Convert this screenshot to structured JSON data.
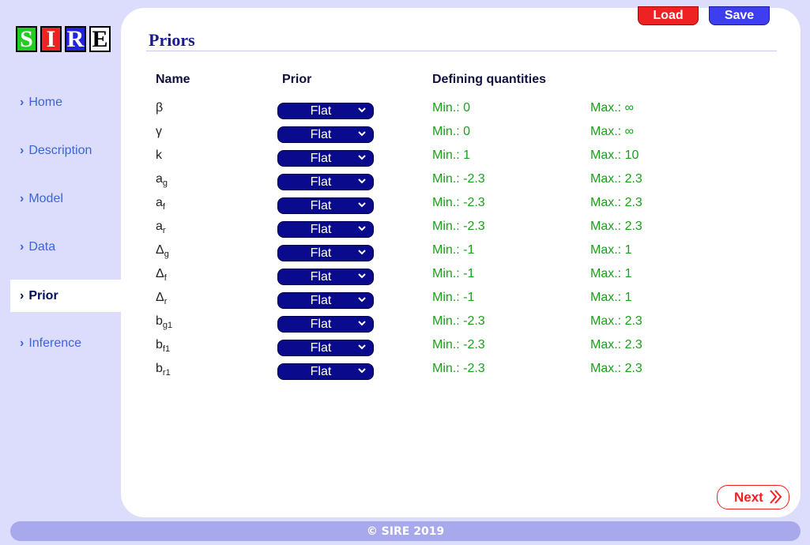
{
  "logo": {
    "letters": [
      {
        "char": "S",
        "color": "#22cc22"
      },
      {
        "char": "I",
        "color": "#ee2222"
      },
      {
        "char": "R",
        "color": "#2222dd"
      },
      {
        "char": "E",
        "color": "#ffffff"
      }
    ]
  },
  "sidebar": {
    "items": [
      {
        "label": "Home",
        "active": false
      },
      {
        "label": "Description",
        "active": false
      },
      {
        "label": "Model",
        "active": false
      },
      {
        "label": "Data",
        "active": false
      },
      {
        "label": "Prior",
        "active": true
      },
      {
        "label": "Inference",
        "active": false
      }
    ]
  },
  "toolbar": {
    "load_label": "Load",
    "save_label": "Save"
  },
  "page": {
    "title": "Priors"
  },
  "table": {
    "headers": {
      "name": "Name",
      "prior": "Prior",
      "defining": "Defining quantities"
    },
    "rows": [
      {
        "sym": "β",
        "sub": "",
        "prior": "Flat",
        "min": "Min.: 0",
        "max": "Max.: ∞"
      },
      {
        "sym": "γ",
        "sub": "",
        "prior": "Flat",
        "min": "Min.: 0",
        "max": "Max.: ∞"
      },
      {
        "sym": "k",
        "sub": "",
        "prior": "Flat",
        "min": "Min.: 1",
        "max": "Max.: 10"
      },
      {
        "sym": "a",
        "sub": "g",
        "prior": "Flat",
        "min": "Min.: -2.3",
        "max": "Max.: 2.3"
      },
      {
        "sym": "a",
        "sub": "f",
        "prior": "Flat",
        "min": "Min.: -2.3",
        "max": "Max.: 2.3"
      },
      {
        "sym": "a",
        "sub": "r",
        "prior": "Flat",
        "min": "Min.: -2.3",
        "max": "Max.: 2.3"
      },
      {
        "sym": "Δ",
        "sub": "g",
        "prior": "Flat",
        "min": "Min.: -1",
        "max": "Max.: 1"
      },
      {
        "sym": "Δ",
        "sub": "f",
        "prior": "Flat",
        "min": "Min.: -1",
        "max": "Max.: 1"
      },
      {
        "sym": "Δ",
        "sub": "r",
        "prior": "Flat",
        "min": "Min.: -1",
        "max": "Max.: 1"
      },
      {
        "sym": "b",
        "sub": "g1",
        "prior": "Flat",
        "min": "Min.: -2.3",
        "max": "Max.: 2.3"
      },
      {
        "sym": "b",
        "sub": "f1",
        "prior": "Flat",
        "min": "Min.: -2.3",
        "max": "Max.: 2.3"
      },
      {
        "sym": "b",
        "sub": "r1",
        "prior": "Flat",
        "min": "Min.: -2.3",
        "max": "Max.: 2.3"
      }
    ]
  },
  "next": {
    "label": "Next",
    "icon": "double-chevron-right-icon"
  },
  "footer": {
    "text": "© SIRE 2019"
  },
  "colors": {
    "background": "#dcdcfc",
    "panel": "#ffffff",
    "title": "#1a1a8c",
    "value_green": "#1aa01a",
    "select_bg": "#0a0a8c",
    "accent_red": "#ee2222",
    "accent_blue": "#3e3ef0"
  }
}
